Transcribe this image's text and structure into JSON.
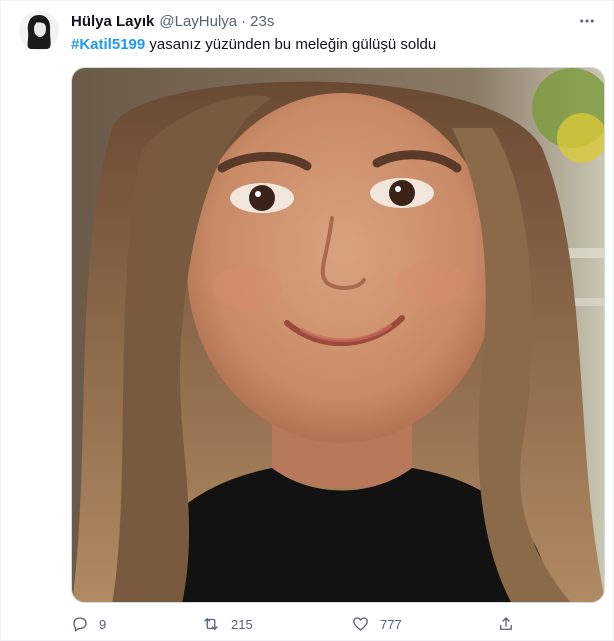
{
  "tweet": {
    "author_name": "Hülya Layık",
    "handle": "@LayHulya",
    "separator": "·",
    "time": "23s",
    "hashtag": "#Katil5199",
    "text": " yasanız yüzünden bu meleğin gülüşü soldu",
    "replies": "9",
    "retweets": "215",
    "likes": "777"
  },
  "icons": {
    "more": "more-icon",
    "reply": "reply-icon",
    "retweet": "retweet-icon",
    "like": "heart-icon",
    "share": "share-icon"
  },
  "colors": {
    "hashtag": "#1d9bf0",
    "secondary_text": "#536471"
  }
}
